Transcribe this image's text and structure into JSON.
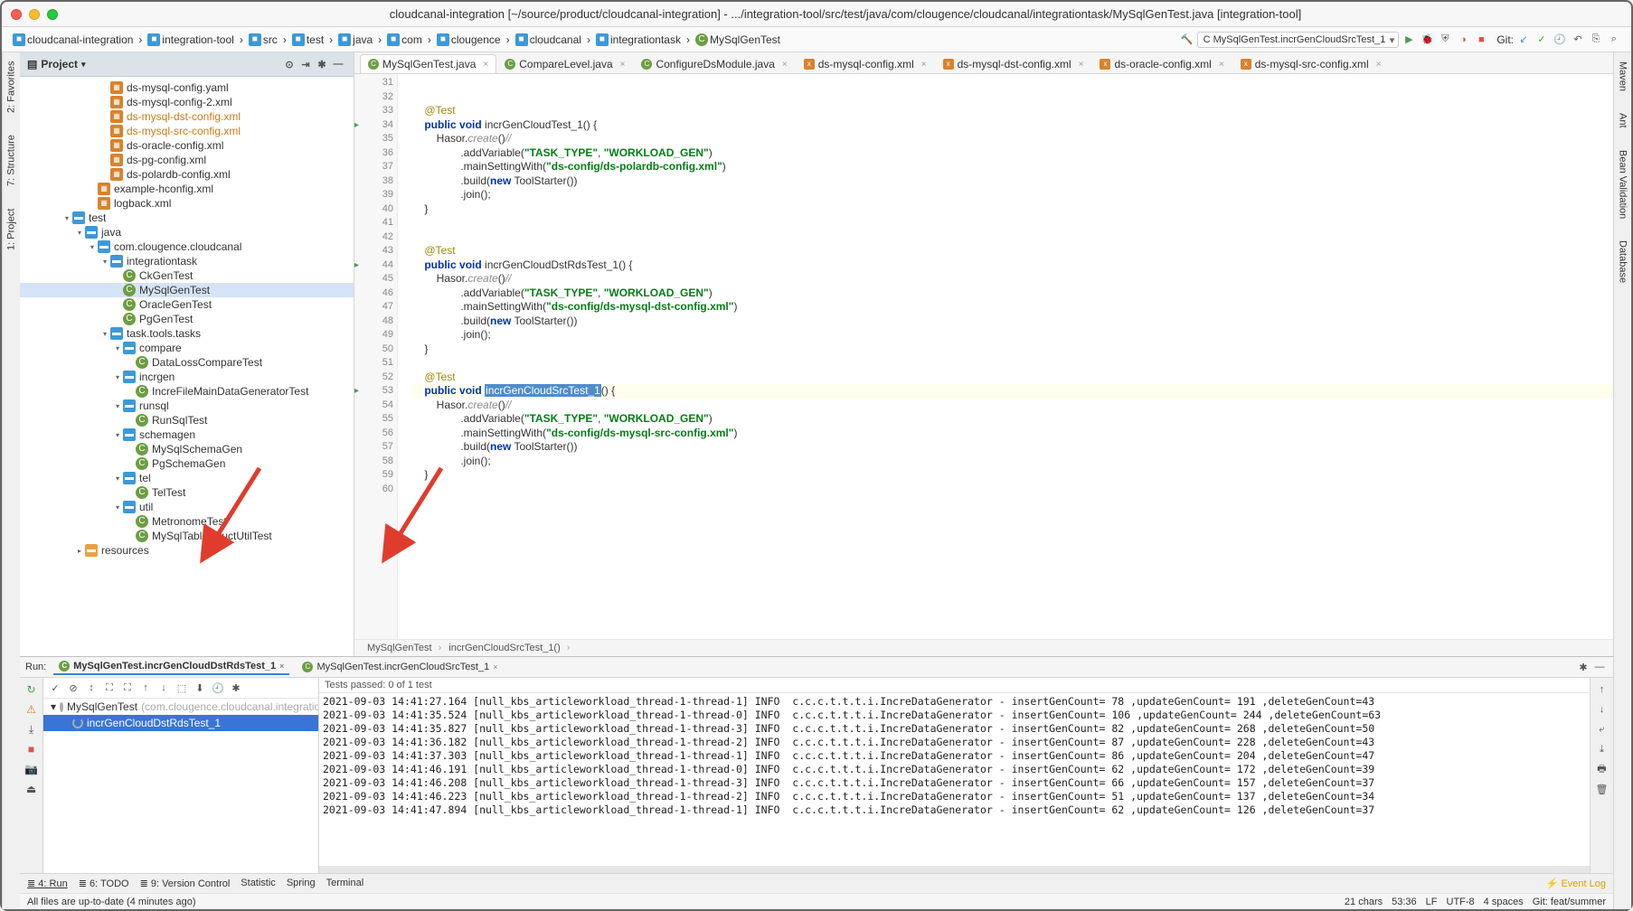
{
  "window": {
    "title": "cloudcanal-integration [~/source/product/cloudcanal-integration] - .../integration-tool/src/test/java/com/clougence/cloudcanal/integrationtask/MySqlGenTest.java [integration-tool]"
  },
  "breadcrumbs": [
    {
      "label": "cloudcanal-integration",
      "icon": "folder"
    },
    {
      "label": "integration-tool",
      "icon": "folder"
    },
    {
      "label": "src",
      "icon": "folder"
    },
    {
      "label": "test",
      "icon": "folder"
    },
    {
      "label": "java",
      "icon": "folder"
    },
    {
      "label": "com",
      "icon": "folder"
    },
    {
      "label": "clougence",
      "icon": "folder"
    },
    {
      "label": "cloudcanal",
      "icon": "folder"
    },
    {
      "label": "integrationtask",
      "icon": "folder"
    },
    {
      "label": "MySqlGenTest",
      "icon": "class"
    }
  ],
  "runconfig": {
    "selected": "MySqlGenTest.incrGenCloudSrcTest_1"
  },
  "git_label": "Git:",
  "project": {
    "header": "Project",
    "tree": [
      {
        "indent": 6,
        "arrow": "",
        "icon": "xml",
        "label": "ds-mysql-config.yaml"
      },
      {
        "indent": 6,
        "arrow": "",
        "icon": "xml",
        "label": "ds-mysql-config-2.xml"
      },
      {
        "indent": 6,
        "arrow": "",
        "icon": "xml",
        "label": "ds-mysql-dst-config.xml",
        "orange": true
      },
      {
        "indent": 6,
        "arrow": "",
        "icon": "xml",
        "label": "ds-mysql-src-config.xml",
        "orange": true
      },
      {
        "indent": 6,
        "arrow": "",
        "icon": "xml",
        "label": "ds-oracle-config.xml"
      },
      {
        "indent": 6,
        "arrow": "",
        "icon": "xml",
        "label": "ds-pg-config.xml"
      },
      {
        "indent": 6,
        "arrow": "",
        "icon": "xml",
        "label": "ds-polardb-config.xml"
      },
      {
        "indent": 5,
        "arrow": "",
        "icon": "xml",
        "label": "example-hconfig.xml"
      },
      {
        "indent": 5,
        "arrow": "",
        "icon": "xml",
        "label": "logback.xml"
      },
      {
        "indent": 3,
        "arrow": "▾",
        "icon": "folder",
        "label": "test"
      },
      {
        "indent": 4,
        "arrow": "▾",
        "icon": "folder",
        "label": "java"
      },
      {
        "indent": 5,
        "arrow": "▾",
        "icon": "folder",
        "label": "com.clougence.cloudcanal"
      },
      {
        "indent": 6,
        "arrow": "▾",
        "icon": "folder",
        "label": "integrationtask"
      },
      {
        "indent": 7,
        "arrow": "",
        "icon": "class",
        "label": "CkGenTest"
      },
      {
        "indent": 7,
        "arrow": "",
        "icon": "class",
        "label": "MySqlGenTest",
        "selected": true
      },
      {
        "indent": 7,
        "arrow": "",
        "icon": "class",
        "label": "OracleGenTest"
      },
      {
        "indent": 7,
        "arrow": "",
        "icon": "class",
        "label": "PgGenTest"
      },
      {
        "indent": 6,
        "arrow": "▾",
        "icon": "folder",
        "label": "task.tools.tasks"
      },
      {
        "indent": 7,
        "arrow": "▾",
        "icon": "folder",
        "label": "compare"
      },
      {
        "indent": 8,
        "arrow": "",
        "icon": "class",
        "label": "DataLossCompareTest"
      },
      {
        "indent": 7,
        "arrow": "▾",
        "icon": "folder",
        "label": "incrgen"
      },
      {
        "indent": 8,
        "arrow": "",
        "icon": "class",
        "label": "IncreFileMainDataGeneratorTest"
      },
      {
        "indent": 7,
        "arrow": "▾",
        "icon": "folder",
        "label": "runsql"
      },
      {
        "indent": 8,
        "arrow": "",
        "icon": "class",
        "label": "RunSqlTest"
      },
      {
        "indent": 7,
        "arrow": "▾",
        "icon": "folder",
        "label": "schemagen"
      },
      {
        "indent": 8,
        "arrow": "",
        "icon": "class",
        "label": "MySqlSchemaGen"
      },
      {
        "indent": 8,
        "arrow": "",
        "icon": "class",
        "label": "PgSchemaGen"
      },
      {
        "indent": 7,
        "arrow": "▾",
        "icon": "folder",
        "label": "tel"
      },
      {
        "indent": 8,
        "arrow": "",
        "icon": "class",
        "label": "TelTest"
      },
      {
        "indent": 7,
        "arrow": "▾",
        "icon": "folder",
        "label": "util"
      },
      {
        "indent": 8,
        "arrow": "",
        "icon": "class",
        "label": "MetronomeTest"
      },
      {
        "indent": 8,
        "arrow": "",
        "icon": "class",
        "label": "MySqlTableStructUtilTest"
      },
      {
        "indent": 4,
        "arrow": "▸",
        "icon": "folder-orange",
        "label": "resources"
      }
    ]
  },
  "editor": {
    "tabs": [
      {
        "label": "MySqlGenTest.java",
        "type": "class",
        "active": true
      },
      {
        "label": "CompareLevel.java",
        "type": "class"
      },
      {
        "label": "ConfigureDsModule.java",
        "type": "class"
      },
      {
        "label": "ds-mysql-config.xml",
        "type": "xml"
      },
      {
        "label": "ds-mysql-dst-config.xml",
        "type": "xml"
      },
      {
        "label": "ds-oracle-config.xml",
        "type": "xml"
      },
      {
        "label": "ds-mysql-src-config.xml",
        "type": "xml"
      }
    ],
    "first_line": 31,
    "breadcrumb": [
      "MySqlGenTest",
      "incrGenCloudSrcTest_1()"
    ]
  },
  "code": {
    "l33": {
      "anno": "@Test"
    },
    "l34": {
      "kw1": "public ",
      "kw2": "void",
      "name": " incrGenCloudTest_1() {"
    },
    "l35": {
      "text": "Hasor.create()//"
    },
    "l36": {
      "p1": ".addVariable(",
      "s1": "\"TASK_TYPE\"",
      "p2": ", ",
      "s2": "\"WORKLOAD_GEN\"",
      "p3": ")"
    },
    "l37": {
      "p1": ".mainSettingWith(",
      "s1": "\"ds-config/ds-polardb-config.xml\"",
      "p2": ")"
    },
    "l38": {
      "p1": ".build(",
      "kw": "new",
      "p2": " ToolStarter())"
    },
    "l39": {
      "text": ".join();"
    },
    "l40": {
      "text": "}"
    },
    "l43": {
      "anno": "@Test"
    },
    "l44": {
      "kw1": "public ",
      "kw2": "void",
      "name": " incrGenCloudDstRdsTest_1() {"
    },
    "l45": {
      "text": "Hasor.create()//"
    },
    "l46": {
      "p1": ".addVariable(",
      "s1": "\"TASK_TYPE\"",
      "p2": ", ",
      "s2": "\"WORKLOAD_GEN\"",
      "p3": ")"
    },
    "l47": {
      "p1": ".mainSettingWith(",
      "s1": "\"ds-config/ds-mysql-dst-config.xml\"",
      "p2": ")"
    },
    "l48": {
      "p1": ".build(",
      "kw": "new",
      "p2": " ToolStarter())"
    },
    "l49": {
      "text": ".join();"
    },
    "l50": {
      "text": "}"
    },
    "l52": {
      "anno": "@Test"
    },
    "l53": {
      "kw1": "public ",
      "kw2": "void",
      "name_pre": " ",
      "sel": "incrGenCloudSrcTest_1",
      "name_post": "() {"
    },
    "l54": {
      "text": "Hasor.create()//"
    },
    "l55": {
      "p1": ".addVariable(",
      "s1": "\"TASK_TYPE\"",
      "p2": ", ",
      "s2": "\"WORKLOAD_GEN\"",
      "p3": ")"
    },
    "l56": {
      "p1": ".mainSettingWith(",
      "s1": "\"ds-config/ds-mysql-src-config.xml\"",
      "p2": ")"
    },
    "l57": {
      "p1": ".build(",
      "kw": "new",
      "p2": " ToolStarter())"
    },
    "l58": {
      "text": ".join();"
    },
    "l59": {
      "text": "}"
    }
  },
  "run": {
    "label": "Run:",
    "tabs": [
      {
        "label": "MySqlGenTest.incrGenCloudDstRdsTest_1",
        "active": true
      },
      {
        "label": "MySqlGenTest.incrGenCloudSrcTest_1"
      }
    ],
    "status": "Tests passed: 0 of 1 test",
    "tree": [
      {
        "label": "MySqlGenTest",
        "hint": "(com.clougence.cloudcanal.integratio"
      },
      {
        "label": "incrGenCloudDstRdsTest_1",
        "selected": true
      }
    ],
    "logs": [
      "2021-09-03 14:41:27.164 [null_kbs_articleworkload_thread-1-thread-1] INFO  c.c.c.t.t.t.i.IncreDataGenerator - insertGenCount= 78 ,updateGenCount= 191 ,deleteGenCount=43",
      "2021-09-03 14:41:35.524 [null_kbs_articleworkload_thread-1-thread-0] INFO  c.c.c.t.t.t.i.IncreDataGenerator - insertGenCount= 106 ,updateGenCount= 244 ,deleteGenCount=63",
      "2021-09-03 14:41:35.827 [null_kbs_articleworkload_thread-1-thread-3] INFO  c.c.c.t.t.t.i.IncreDataGenerator - insertGenCount= 82 ,updateGenCount= 268 ,deleteGenCount=50",
      "2021-09-03 14:41:36.182 [null_kbs_articleworkload_thread-1-thread-2] INFO  c.c.c.t.t.t.i.IncreDataGenerator - insertGenCount= 87 ,updateGenCount= 228 ,deleteGenCount=43",
      "2021-09-03 14:41:37.303 [null_kbs_articleworkload_thread-1-thread-1] INFO  c.c.c.t.t.t.i.IncreDataGenerator - insertGenCount= 86 ,updateGenCount= 204 ,deleteGenCount=47",
      "2021-09-03 14:41:46.191 [null_kbs_articleworkload_thread-1-thread-0] INFO  c.c.c.t.t.t.i.IncreDataGenerator - insertGenCount= 62 ,updateGenCount= 172 ,deleteGenCount=39",
      "2021-09-03 14:41:46.208 [null_kbs_articleworkload_thread-1-thread-3] INFO  c.c.c.t.t.t.i.IncreDataGenerator - insertGenCount= 66 ,updateGenCount= 157 ,deleteGenCount=37",
      "2021-09-03 14:41:46.223 [null_kbs_articleworkload_thread-1-thread-2] INFO  c.c.c.t.t.t.i.IncreDataGenerator - insertGenCount= 51 ,updateGenCount= 137 ,deleteGenCount=34",
      "2021-09-03 14:41:47.894 [null_kbs_articleworkload_thread-1-thread-1] INFO  c.c.c.t.t.t.i.IncreDataGenerator - insertGenCount= 62 ,updateGenCount= 126 ,deleteGenCount=37"
    ]
  },
  "bottom": {
    "items": [
      "4: Run",
      "6: TODO",
      "9: Version Control",
      "Statistic",
      "Spring",
      "Terminal"
    ],
    "event_log": "Event Log"
  },
  "status": {
    "msg": "All files are up-to-date (4 minutes ago)",
    "right": [
      "21 chars",
      "53:36",
      "LF",
      "UTF-8",
      "4 spaces",
      "Git: feat/summer"
    ]
  },
  "right_tools": [
    "Maven",
    "Ant",
    "Bean Validation",
    "Database"
  ],
  "left_tools": [
    "1: Project",
    "7: Structure",
    "2: Favorites"
  ]
}
